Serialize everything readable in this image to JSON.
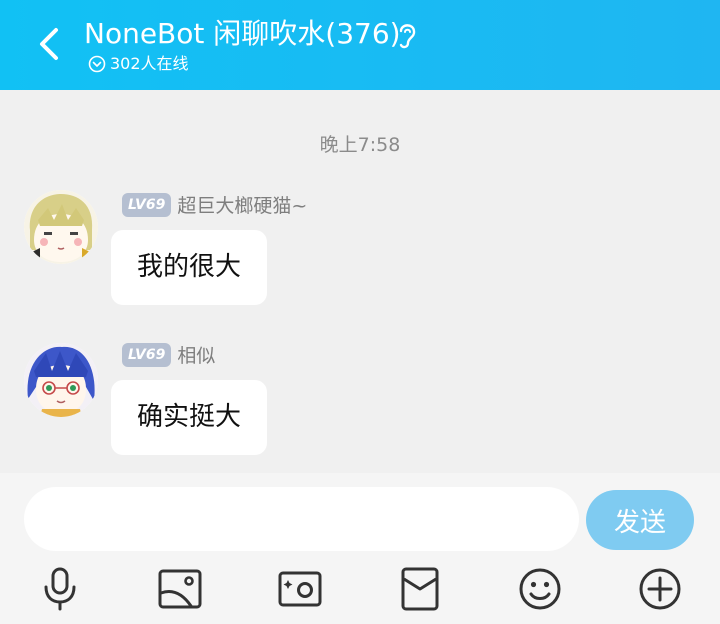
{
  "header": {
    "title": "NoneBot 闲聊吹水(376)",
    "online_text": "302人在线",
    "back_icon": "back-arrow-icon",
    "ear_icon": "ear-icon"
  },
  "chat": {
    "timestamp": "晚上7:58",
    "messages": [
      {
        "level": "LV69",
        "nickname": "超巨大榔硬猫~",
        "text": "我的很大",
        "avatar": "avatar-blonde-anime"
      },
      {
        "level": "LV69",
        "nickname": "相似",
        "text": "确实挺大",
        "avatar": "avatar-blue-hair-anime"
      }
    ]
  },
  "input": {
    "value": "",
    "placeholder": "",
    "send_label": "发送"
  },
  "toolbar": [
    "microphone-icon",
    "image-icon",
    "camera-icon",
    "red-packet-icon",
    "emoji-icon",
    "plus-icon"
  ],
  "colors": {
    "header_bg": "#1fb6f2",
    "level_badge": "#b5bfd1",
    "send_button": "#7fcbf1",
    "chat_bg": "#f0f0f0"
  }
}
